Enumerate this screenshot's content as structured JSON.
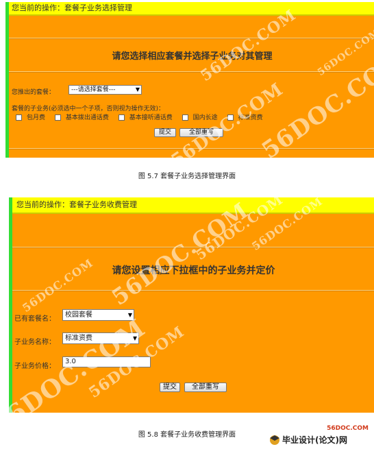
{
  "figure1": {
    "header": "您当前的操作：套餐子业务选择管理",
    "title": "请您选择相应套餐并选择子业务对其管理",
    "package_label": "您推出的套餐：",
    "package_select": "---请选择套餐---",
    "subservice_label": "套餐的子业务(必须选中一个子项，否则视为操作无效)：",
    "checkboxes": [
      "包月费",
      "基本拨出通话费",
      "基本接听通话费",
      "国内长途",
      "标准资费"
    ],
    "submit": "提交",
    "reset": "全部重写",
    "caption": "图 5.7 套餐子业务选择管理界面"
  },
  "figure2": {
    "header": "您当前的操作：套餐子业务收费管理",
    "title": "请您设置相应下拉框中的子业务并定价",
    "package_label": "已有套餐名：",
    "package_select": "校园套餐",
    "subservice_label": "子业务名称：",
    "subservice_select": "标准资费",
    "price_label": "子业务价格：",
    "price_value": "3.0",
    "submit": "提交",
    "reset": "全部重写",
    "caption": "图 5.8  套餐子业务收费管理界面"
  },
  "watermark": "56DOC.COM",
  "logo": {
    "url_text": "56DOC.COM",
    "site_name": "毕业设计(论文)网"
  },
  "colors": {
    "panel": "#ff9900",
    "header": "#ffff00",
    "left_bar": "#33dd33",
    "accent_bar": "#e2479c"
  }
}
